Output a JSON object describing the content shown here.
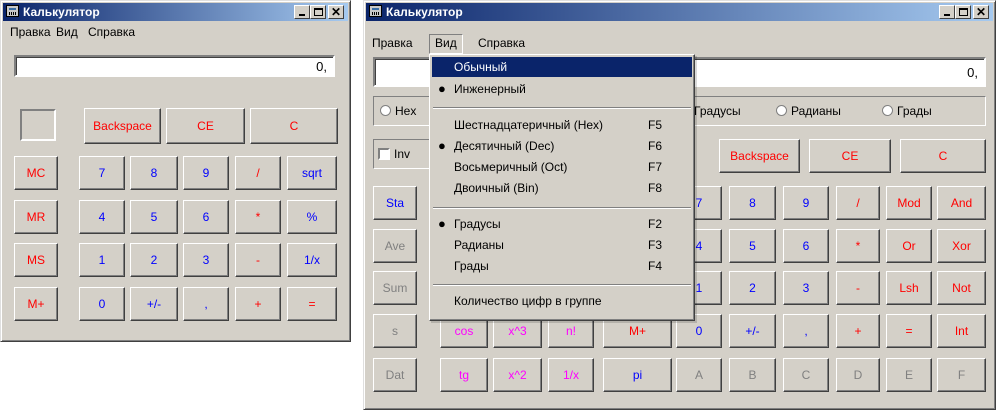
{
  "left": {
    "title": "Калькулятор",
    "menu": [
      "Правка",
      "Вид",
      "Справка"
    ],
    "display": "0,",
    "top_buttons": [
      "Backspace",
      "CE",
      "C"
    ],
    "mem_buttons": [
      "MC",
      "MR",
      "MS",
      "M+"
    ],
    "num_rows": [
      [
        "7",
        "8",
        "9",
        "/",
        "sqrt"
      ],
      [
        "4",
        "5",
        "6",
        "*",
        "%"
      ],
      [
        "1",
        "2",
        "3",
        "-",
        "1/x"
      ],
      [
        "0",
        "+/-",
        ",",
        "+",
        "="
      ]
    ]
  },
  "right": {
    "title": "Калькулятор",
    "menu": [
      "Правка",
      "Вид",
      "Справка"
    ],
    "display": "0,",
    "radix_partial": "Hex",
    "angles": [
      "Градусы",
      "Радианы",
      "Грады"
    ],
    "inv_label": "Inv",
    "top_buttons": [
      "Backspace",
      "CE",
      "C"
    ],
    "stat_buttons": [
      "Sta",
      "Ave",
      "Sum",
      "s",
      "Dat"
    ],
    "sci_row4": [
      "cos",
      "x^3",
      "n!",
      "M+"
    ],
    "sci_row5": [
      "tg",
      "x^2",
      "1/x",
      "pi"
    ],
    "num_rows": [
      [
        "7",
        "8",
        "9",
        "/",
        "Mod",
        "And"
      ],
      [
        "4",
        "5",
        "6",
        "*",
        "Or",
        "Xor"
      ],
      [
        "1",
        "2",
        "3",
        "-",
        "Lsh",
        "Not"
      ],
      [
        "0",
        "+/-",
        ",",
        "+",
        "=",
        "Int"
      ],
      [
        "A",
        "B",
        "C",
        "D",
        "E",
        "F"
      ]
    ]
  },
  "dropdown": {
    "items": [
      {
        "label": "Обычный",
        "shortcut": "",
        "checked": false,
        "highlighted": true
      },
      {
        "label": "Инженерный",
        "shortcut": "",
        "checked": true,
        "highlighted": false
      },
      {
        "label": "Шестнадцатеричный (Hex)",
        "shortcut": "F5",
        "checked": false,
        "highlighted": false
      },
      {
        "label": "Десятичный (Dec)",
        "shortcut": "F6",
        "checked": true,
        "highlighted": false
      },
      {
        "label": "Восьмеричный (Oct)",
        "shortcut": "F7",
        "checked": false,
        "highlighted": false
      },
      {
        "label": "Двоичный (Bin)",
        "shortcut": "F8",
        "checked": false,
        "highlighted": false
      },
      {
        "label": "Градусы",
        "shortcut": "F2",
        "checked": true,
        "highlighted": false
      },
      {
        "label": "Радианы",
        "shortcut": "F3",
        "checked": false,
        "highlighted": false
      },
      {
        "label": "Грады",
        "shortcut": "F4",
        "checked": false,
        "highlighted": false
      },
      {
        "label": "Количество цифр в группе",
        "shortcut": "",
        "checked": false,
        "highlighted": false
      }
    ]
  },
  "colors": {
    "face": "#d4d0c8",
    "title_active": "#0a246a",
    "title_gradient_end": "#a6caf0",
    "red": "#ff0000",
    "blue": "#0000ff",
    "magenta": "#ff00ff",
    "disabled": "#808080"
  }
}
